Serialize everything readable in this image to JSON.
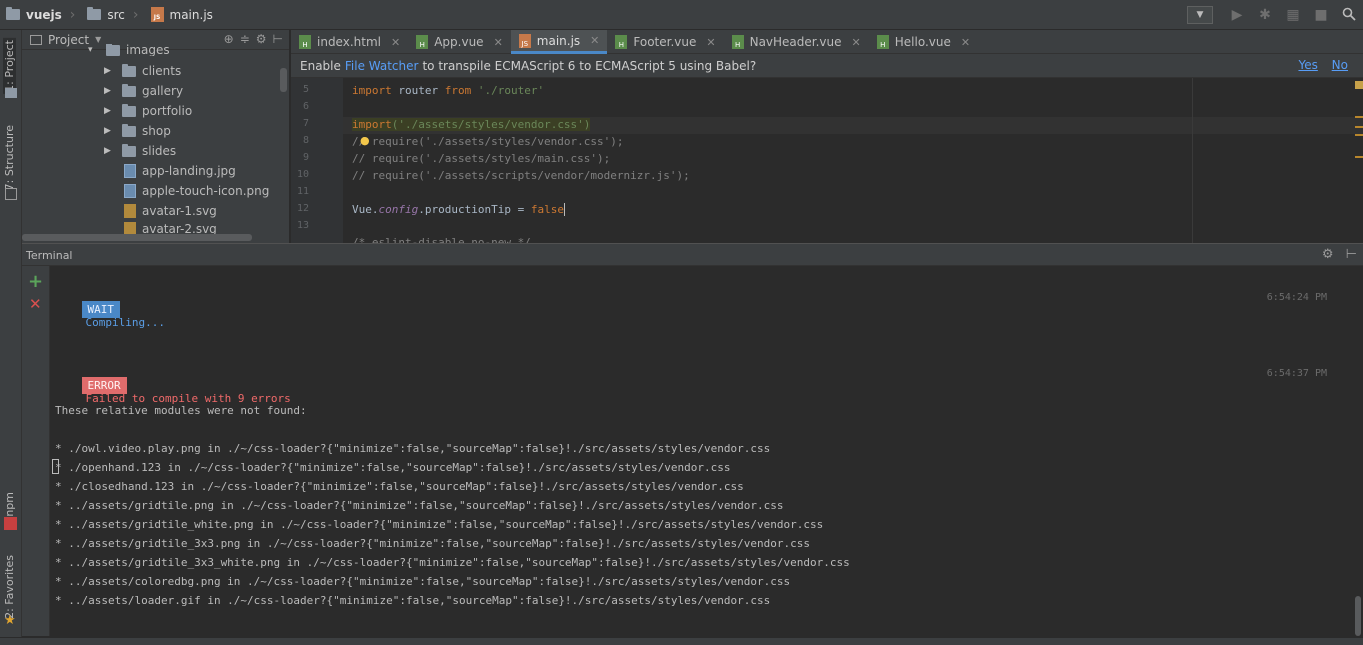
{
  "breadcrumb": {
    "project": "vuejs",
    "folder": "src",
    "file": "main.js"
  },
  "toolbar": {
    "dropdown_icon": "triangle-down",
    "run_icon": "play-icon",
    "debug_icon": "bug-icon",
    "coverage_icon": "coverage-icon",
    "stop_icon": "stop-icon",
    "search_icon": "search-icon"
  },
  "left_strip": {
    "project_tab": "1: Project",
    "structure_tab": "7: Structure",
    "npm_tab": "npm",
    "favorites_tab": "2: Favorites"
  },
  "project_panel": {
    "title": "Project",
    "parent_item": "images",
    "folders": [
      "clients",
      "gallery",
      "portfolio",
      "shop",
      "slides"
    ],
    "files": [
      "app-landing.jpg",
      "apple-touch-icon.png",
      "avatar-1.svg",
      "avatar-2.svg"
    ]
  },
  "editor": {
    "tabs": [
      {
        "label": "index.html",
        "active": false
      },
      {
        "label": "App.vue",
        "active": false
      },
      {
        "label": "main.js",
        "active": true
      },
      {
        "label": "Footer.vue",
        "active": false
      },
      {
        "label": "NavHeader.vue",
        "active": false
      },
      {
        "label": "Hello.vue",
        "active": false
      }
    ],
    "notice": {
      "prefix": "Enable",
      "link": "File Watcher",
      "suffix": "to transpile ECMAScript 6 to ECMAScript 5 using Babel?",
      "yes": "Yes",
      "no": "No"
    },
    "line_numbers": [
      "5",
      "6",
      "7",
      "8",
      "9",
      "10",
      "11",
      "12",
      "13"
    ],
    "lines": {
      "l5_kw": "import",
      "l5_mid": " router ",
      "l5_from": "from",
      "l5_str": " './router'",
      "l7_kw": "import",
      "l7_str": "('./assets/styles/vendor.css')",
      "l8": "// require('./assets/styles/vendor.css');",
      "l9": "// require('./assets/styles/main.css');",
      "l10": "// require('./assets/scripts/vendor/modernizr.js');",
      "l12_obj": "Vue.",
      "l12_prop": "config",
      "l12_rest": ".productionTip = ",
      "l12_val": "false",
      "l13": "/* eslint-disable no-new */"
    }
  },
  "terminal": {
    "title": "Terminal",
    "wait_badge": "WAIT",
    "wait_text": "Compiling...",
    "wait_time": "6:54:24 PM",
    "error_badge": "ERROR",
    "error_text": "Failed to compile with 9 errors",
    "error_time": "6:54:37 PM",
    "not_found": "These relative modules were not found:",
    "errors": [
      "* ./owl.video.play.png in ./~/css-loader?{\"minimize\":false,\"sourceMap\":false}!./src/assets/styles/vendor.css",
      "* ./openhand.123 in ./~/css-loader?{\"minimize\":false,\"sourceMap\":false}!./src/assets/styles/vendor.css",
      "* ./closedhand.123 in ./~/css-loader?{\"minimize\":false,\"sourceMap\":false}!./src/assets/styles/vendor.css",
      "* ../assets/gridtile.png in ./~/css-loader?{\"minimize\":false,\"sourceMap\":false}!./src/assets/styles/vendor.css",
      "* ../assets/gridtile_white.png in ./~/css-loader?{\"minimize\":false,\"sourceMap\":false}!./src/assets/styles/vendor.css",
      "* ../assets/gridtile_3x3.png in ./~/css-loader?{\"minimize\":false,\"sourceMap\":false}!./src/assets/styles/vendor.css",
      "* ../assets/gridtile_3x3_white.png in ./~/css-loader?{\"minimize\":false,\"sourceMap\":false}!./src/assets/styles/vendor.css",
      "* ../assets/coloredbg.png in ./~/css-loader?{\"minimize\":false,\"sourceMap\":false}!./src/assets/styles/vendor.css",
      "* ../assets/loader.gif in ./~/css-loader?{\"minimize\":false,\"sourceMap\":false}!./src/assets/styles/vendor.css"
    ]
  }
}
